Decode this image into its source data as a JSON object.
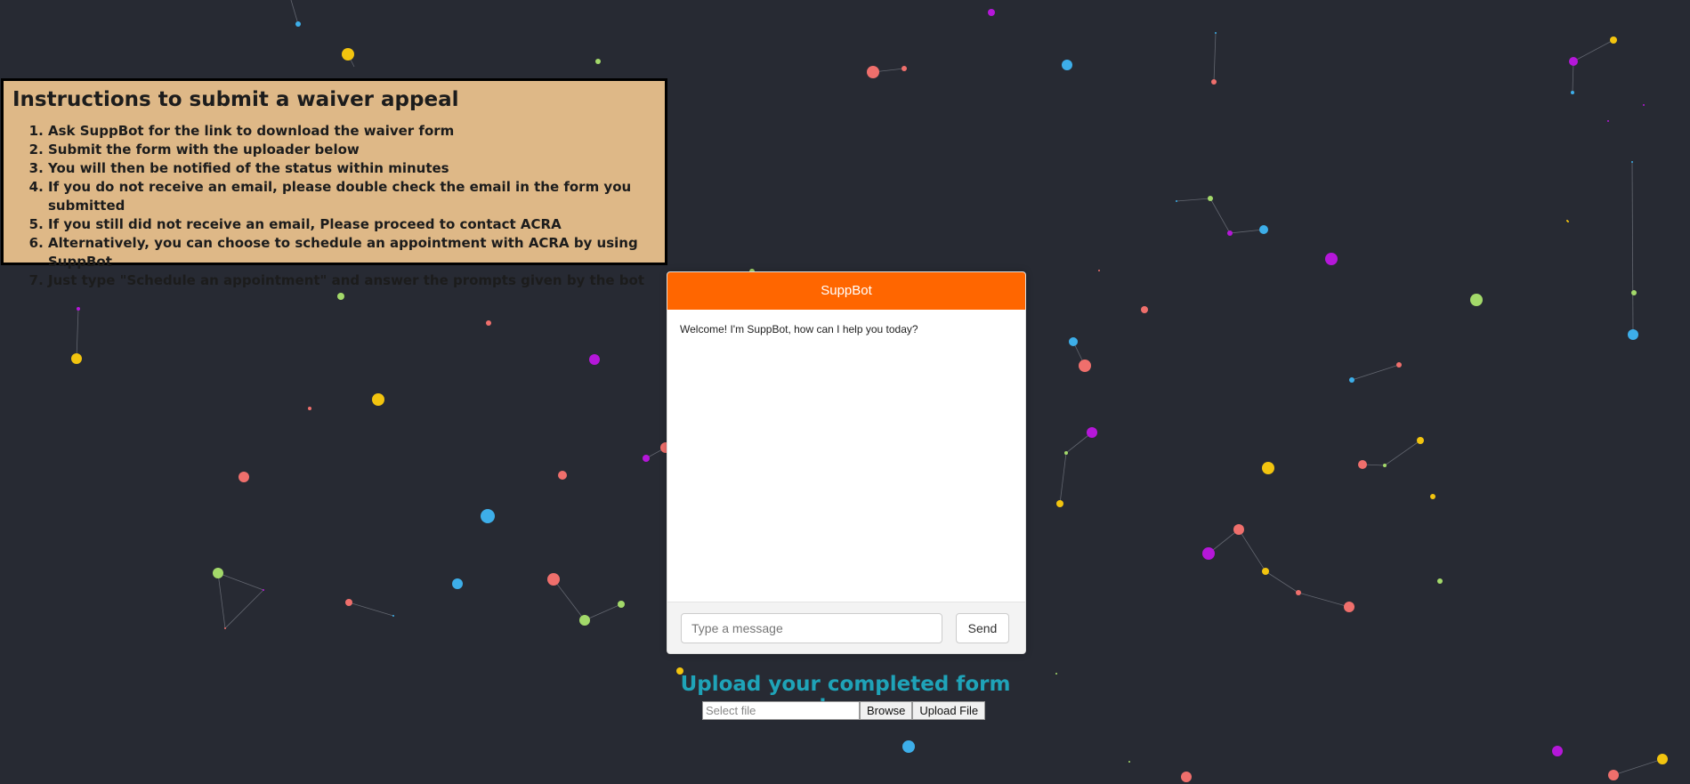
{
  "instructions": {
    "title": "Instructions to submit a waiver appeal",
    "steps": [
      "Ask SuppBot for the link to download the waiver form",
      "Submit the form with the uploader below",
      "You will then be notified of the status within minutes",
      "If you do not receive an email, please double check the email in the form you submitted",
      "If you still did not receive an email, Please proceed to contact ACRA",
      "Alternatively, you can choose to schedule an appointment with ACRA by using SuppBot",
      "Just type \"Schedule an appointment\" and answer the prompts given by the bot"
    ]
  },
  "chat": {
    "header": "SuppBot",
    "welcome": "Welcome! I'm SuppBot, how can I help you today?",
    "input_placeholder": "Type a message",
    "send_label": "Send"
  },
  "upload": {
    "title": "Upload your completed form here",
    "file_placeholder": "Select file",
    "browse_label": "Browse",
    "upload_label": "Upload File"
  },
  "colors": {
    "background": "#272a33",
    "instructions_bg": "#deb887",
    "chat_header": "#ff6600",
    "upload_title": "#1fa3b8",
    "particles": [
      "#ef6f6c",
      "#f2c40f",
      "#3daee9",
      "#b517d9",
      "#a3d96a"
    ]
  }
}
